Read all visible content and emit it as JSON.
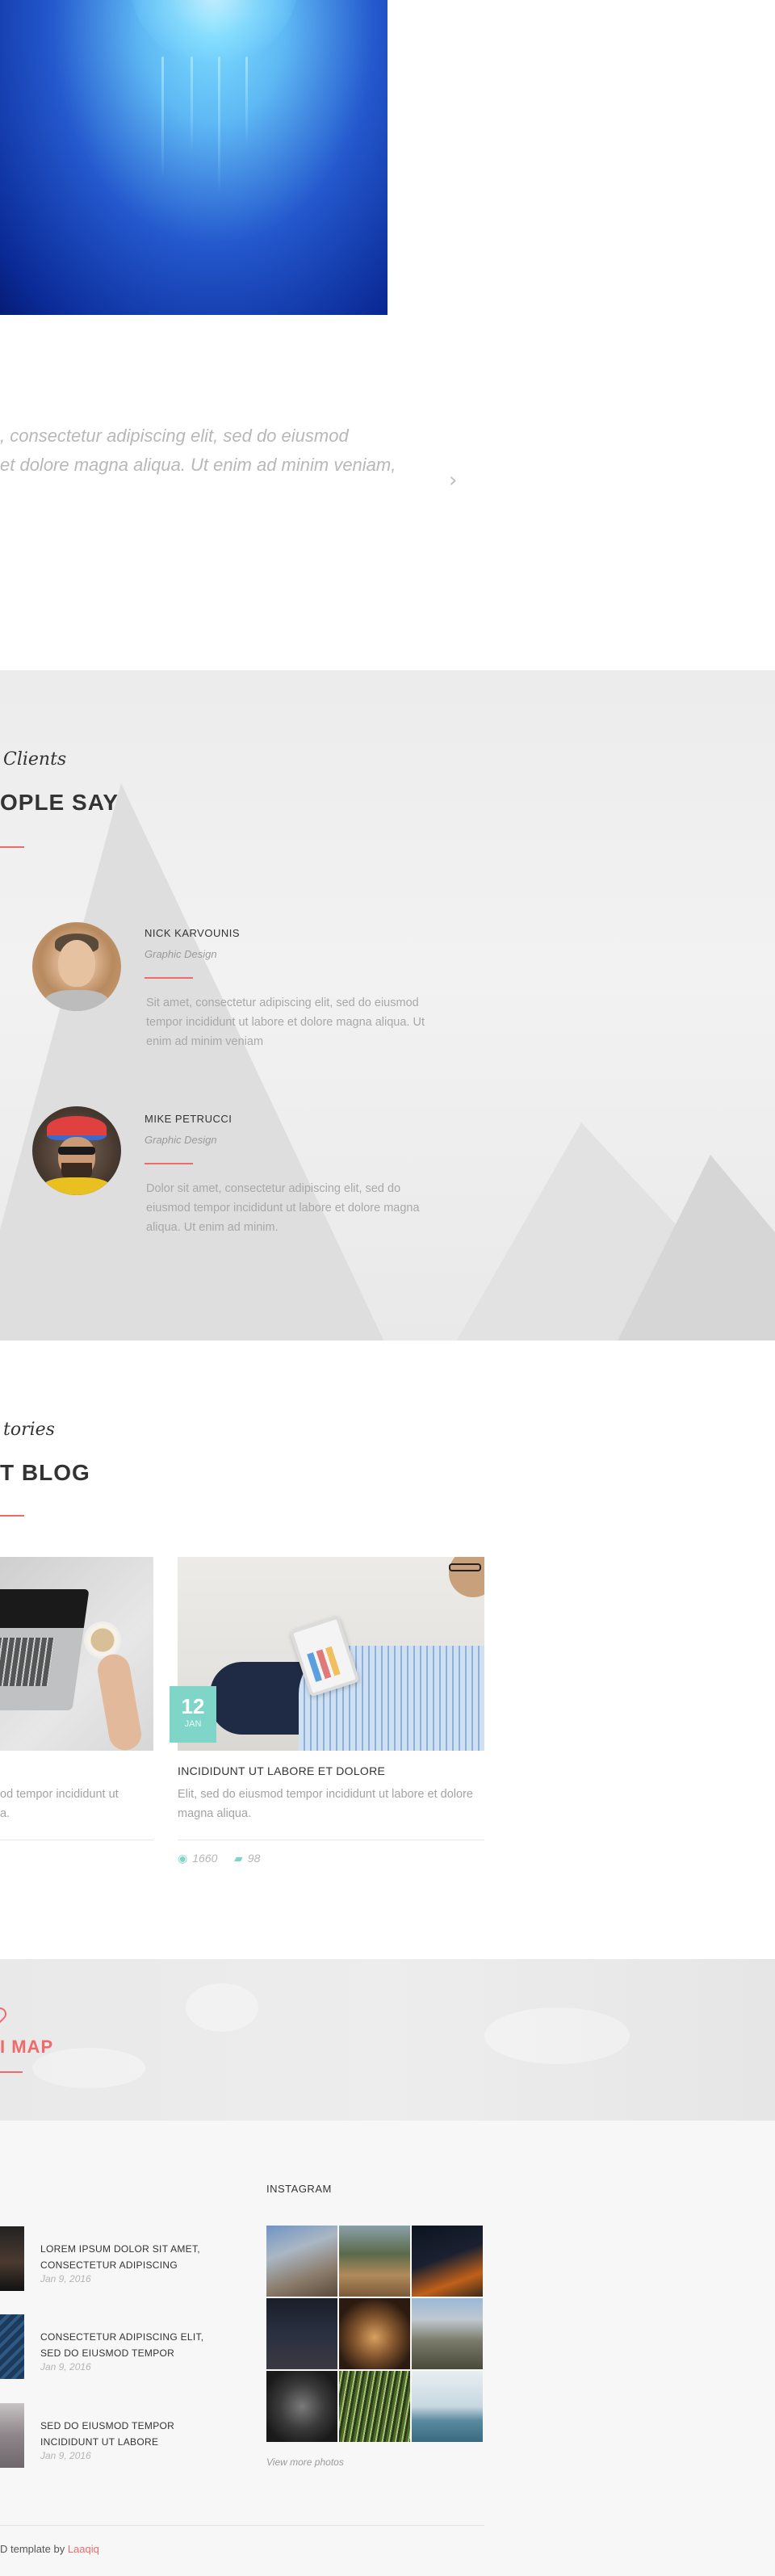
{
  "quote": {
    "line1": ", consectetur adipiscing elit, sed do eiusmod",
    "line2": "et dolore magna aliqua. Ut enim ad minim veniam,",
    "next_icon": "›"
  },
  "testimonials": {
    "script_heading": "Clients",
    "title": "OPLE SAY",
    "people": [
      {
        "name": "NICK KARVOUNIS",
        "role": "Graphic Design",
        "text": "Sit amet, consectetur adipiscing elit, sed do eiusmod tempor incididunt ut labore et dolore magna aliqua. Ut enim ad minim veniam"
      },
      {
        "name": "MIKE PETRUCCI",
        "role": "Graphic Design",
        "text": "Dolor sit amet, consectetur adipiscing elit, sed do eiusmod tempor incididunt ut labore et dolore magna aliqua. Ut enim ad minim."
      }
    ]
  },
  "blog": {
    "script_heading": "tories",
    "title": "T BLOG",
    "posts": [
      {
        "excerpt": "od tempor incididunt ut\na."
      },
      {
        "date_day": "12",
        "date_month": "JAN",
        "title": "INCIDIDUNT UT LABORE ET DOLORE",
        "excerpt": "Elit, sed do eiusmod tempor incididunt ut labore et dolore magna aliqua.",
        "views": "1660",
        "comments": "98"
      }
    ]
  },
  "map": {
    "title": "I MAP",
    "pin_icon": "map-pin-icon"
  },
  "footer": {
    "recent_posts": [
      {
        "title": "LOREM IPSUM DOLOR SIT AMET, CONSECTETUR ADIPISCING",
        "date": "Jan 9, 2016"
      },
      {
        "title": "CONSECTETUR ADIPISCING ELIT, SED DO EIUSMOD TEMPOR",
        "date": "Jan 9, 2016"
      },
      {
        "title": "SED DO EIUSMOD TEMPOR INCIDIDUNT UT LABORE",
        "date": "Jan 9, 2016"
      }
    ],
    "instagram": {
      "heading": "INSTAGRAM",
      "more_label": "View more photos"
    },
    "copyright_text": "D template by",
    "copyright_link": "Laaqiq"
  },
  "colors": {
    "accent": "#ef6b6b",
    "teal": "#7fd6c8"
  }
}
